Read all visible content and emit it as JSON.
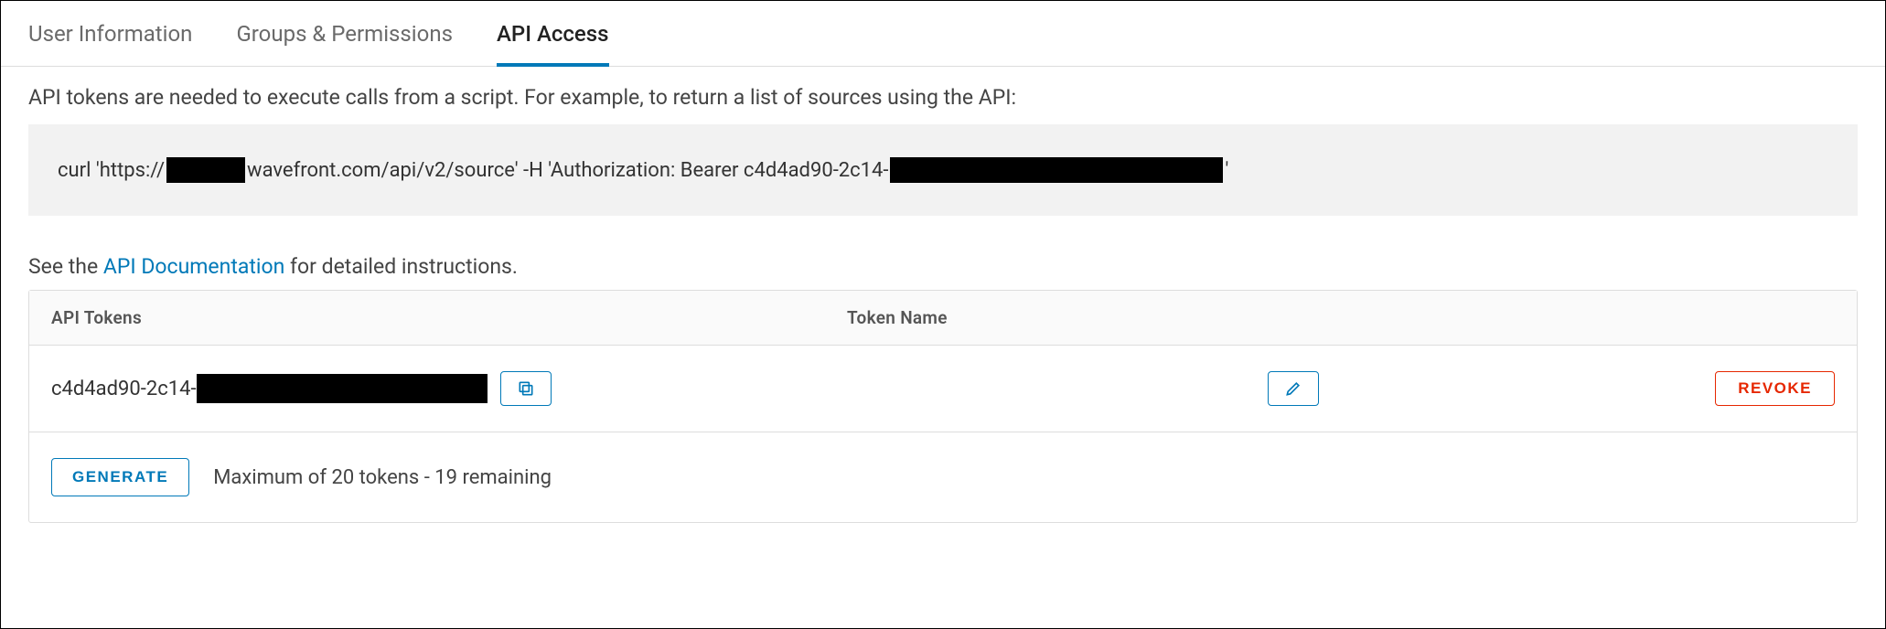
{
  "tabs": {
    "user_info": "User Information",
    "groups": "Groups & Permissions",
    "api_access": "API Access"
  },
  "intro": "API tokens are needed to execute calls from a script. For example, to return a list of sources using the API:",
  "curl": {
    "part1": "curl 'https://",
    "part2": "wavefront.com/api/v2/source' -H 'Authorization: Bearer c4d4ad90-2c14-",
    "part3": "'"
  },
  "doc_prefix": "See the ",
  "doc_link": "API Documentation",
  "doc_suffix": " for detailed instructions.",
  "table": {
    "header_tokens": "API Tokens",
    "header_name": "Token Name",
    "row": {
      "token_prefix": "c4d4ad90-2c14-"
    },
    "revoke": "REVOKE",
    "generate": "GENERATE",
    "footer": "Maximum of 20 tokens - 19 remaining"
  }
}
